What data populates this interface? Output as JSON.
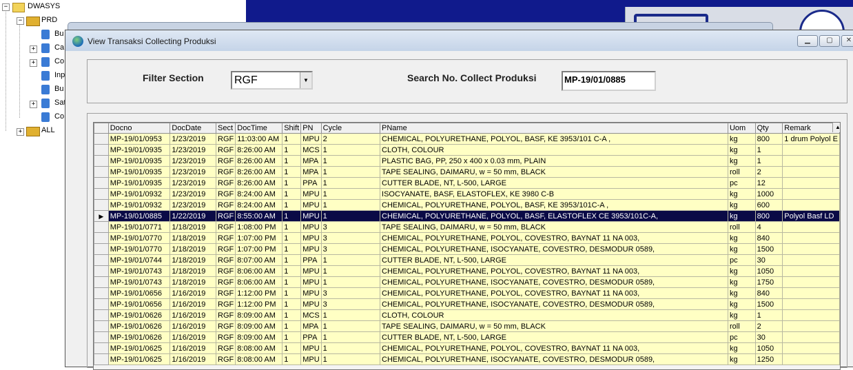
{
  "tree": {
    "root": "DWASYS",
    "prd": "PRD",
    "children": [
      "Bu",
      "Ca",
      "Co",
      "Inp",
      "Bu",
      "Sat",
      "Co"
    ],
    "all": "ALL"
  },
  "window": {
    "title": "View Transaksi Collecting Produksi",
    "min_glyph": "▁",
    "max_glyph": "▢",
    "close_glyph": "✕"
  },
  "filter": {
    "section_label": "Filter Section",
    "section_value": "RGF",
    "search_label": "Search No. Collect Produksi",
    "search_value": "MP-19/01/0885"
  },
  "grid": {
    "columns": [
      "Docno",
      "DocDate",
      "Sect",
      "DocTime",
      "Shift",
      "PN",
      "Cycle",
      "PName",
      "Uom",
      "Qty",
      "Remark"
    ],
    "rows": [
      [
        "MP-19/01/0953",
        "1/23/2019",
        "RGF",
        "11:03:00 AM",
        "1",
        "MPU",
        "2",
        "CHEMICAL, POLYURETHANE, POLYOL, BASF, KE 3953/101 C-A ,",
        "kg",
        "800",
        "1 drum Polyol E"
      ],
      [
        "MP-19/01/0935",
        "1/23/2019",
        "RGF",
        "8:26:00 AM",
        "1",
        "MCS",
        "1",
        "CLOTH, COLOUR",
        "kg",
        "1",
        ""
      ],
      [
        "MP-19/01/0935",
        "1/23/2019",
        "RGF",
        "8:26:00 AM",
        "1",
        "MPA",
        "1",
        "PLASTIC BAG, PP,  250 x  400 x 0.03 mm, PLAIN",
        "kg",
        "1",
        ""
      ],
      [
        "MP-19/01/0935",
        "1/23/2019",
        "RGF",
        "8:26:00 AM",
        "1",
        "MPA",
        "1",
        "TAPE SEALING, DAIMARU, w = 50 mm, BLACK",
        "roll",
        "2",
        ""
      ],
      [
        "MP-19/01/0935",
        "1/23/2019",
        "RGF",
        "8:26:00 AM",
        "1",
        "PPA",
        "1",
        "CUTTER BLADE, NT, L-500, LARGE",
        "pc",
        "12",
        ""
      ],
      [
        "MP-19/01/0932",
        "1/23/2019",
        "RGF",
        "8:24:00 AM",
        "1",
        "MPU",
        "1",
        "ISOCYANATE, BASF, ELASTOFLEX, KE 3980 C-B",
        "kg",
        "1000",
        ""
      ],
      [
        "MP-19/01/0932",
        "1/23/2019",
        "RGF",
        "8:24:00 AM",
        "1",
        "MPU",
        "1",
        "CHEMICAL, POLYURETHANE, POLYOL, BASF, KE 3953/101C-A ,",
        "kg",
        "600",
        ""
      ],
      [
        "MP-19/01/0885",
        "1/22/2019",
        "RGF",
        "8:55:00 AM",
        "1",
        "MPU",
        "1",
        "CHEMICAL, POLYURETHANE, POLYOL, BASF, ELASTOFLEX CE 3953/101C-A,",
        "kg",
        "800",
        "Polyol Basf LD"
      ],
      [
        "MP-19/01/0771",
        "1/18/2019",
        "RGF",
        "1:08:00 PM",
        "1",
        "MPU",
        "3",
        "TAPE SEALING, DAIMARU, w = 50 mm, BLACK",
        "roll",
        "4",
        ""
      ],
      [
        "MP-19/01/0770",
        "1/18/2019",
        "RGF",
        "1:07:00 PM",
        "1",
        "MPU",
        "3",
        "CHEMICAL, POLYURETHANE, POLYOL, COVESTRO, BAYNAT 11 NA 003,",
        "kg",
        "840",
        ""
      ],
      [
        "MP-19/01/0770",
        "1/18/2019",
        "RGF",
        "1:07:00 PM",
        "1",
        "MPU",
        "3",
        "CHEMICAL, POLYURETHANE, ISOCYANATE, COVESTRO, DESMODUR 0589,",
        "kg",
        "1500",
        ""
      ],
      [
        "MP-19/01/0744",
        "1/18/2019",
        "RGF",
        "8:07:00 AM",
        "1",
        "PPA",
        "1",
        "CUTTER BLADE, NT, L-500, LARGE",
        "pc",
        "30",
        ""
      ],
      [
        "MP-19/01/0743",
        "1/18/2019",
        "RGF",
        "8:06:00 AM",
        "1",
        "MPU",
        "1",
        "CHEMICAL, POLYURETHANE, POLYOL, COVESTRO, BAYNAT 11 NA 003,",
        "kg",
        "1050",
        ""
      ],
      [
        "MP-19/01/0743",
        "1/18/2019",
        "RGF",
        "8:06:00 AM",
        "1",
        "MPU",
        "1",
        "CHEMICAL, POLYURETHANE, ISOCYANATE, COVESTRO, DESMODUR 0589,",
        "kg",
        "1750",
        ""
      ],
      [
        "MP-19/01/0656",
        "1/16/2019",
        "RGF",
        "1:12:00 PM",
        "1",
        "MPU",
        "3",
        "CHEMICAL, POLYURETHANE, POLYOL, COVESTRO, BAYNAT 11 NA 003,",
        "kg",
        "840",
        ""
      ],
      [
        "MP-19/01/0656",
        "1/16/2019",
        "RGF",
        "1:12:00 PM",
        "1",
        "MPU",
        "3",
        "CHEMICAL, POLYURETHANE, ISOCYANATE, COVESTRO, DESMODUR 0589,",
        "kg",
        "1500",
        ""
      ],
      [
        "MP-19/01/0626",
        "1/16/2019",
        "RGF",
        "8:09:00 AM",
        "1",
        "MCS",
        "1",
        "CLOTH, COLOUR",
        "kg",
        "1",
        ""
      ],
      [
        "MP-19/01/0626",
        "1/16/2019",
        "RGF",
        "8:09:00 AM",
        "1",
        "MPA",
        "1",
        "TAPE SEALING, DAIMARU, w = 50 mm, BLACK",
        "roll",
        "2",
        ""
      ],
      [
        "MP-19/01/0626",
        "1/16/2019",
        "RGF",
        "8:09:00 AM",
        "1",
        "PPA",
        "1",
        "CUTTER BLADE, NT, L-500, LARGE",
        "pc",
        "30",
        ""
      ],
      [
        "MP-19/01/0625",
        "1/16/2019",
        "RGF",
        "8:08:00 AM",
        "1",
        "MPU",
        "1",
        "CHEMICAL, POLYURETHANE, POLYOL, COVESTRO, BAYNAT 11 NA 003,",
        "kg",
        "1050",
        ""
      ],
      [
        "MP-19/01/0625",
        "1/16/2019",
        "RGF",
        "8:08:00 AM",
        "1",
        "MPU",
        "1",
        "CHEMICAL, POLYURETHANE, ISOCYANATE, COVESTRO, DESMODUR 0589,",
        "kg",
        "1250",
        ""
      ]
    ],
    "selected_row": 7,
    "row_pointer_glyph": "▶",
    "scroll_up_glyph": "▲"
  }
}
